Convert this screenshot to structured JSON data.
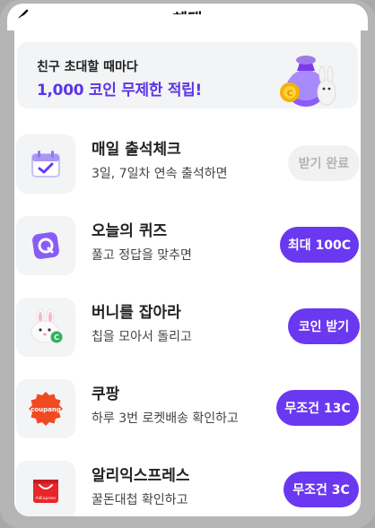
{
  "header": {
    "title": "혜택"
  },
  "banner": {
    "line1": "친구 초대할 때마다",
    "line2": "1,000 코인 무제한 적립!"
  },
  "items": [
    {
      "title": "매일 출석체크",
      "subtitle": "3일, 7일차 연속 출석하면",
      "button": "받기 완료",
      "icon": "calendar-check-icon",
      "done": true
    },
    {
      "title": "오늘의 퀴즈",
      "subtitle": "풀고 정답을 맞추면",
      "button": "최대 100C",
      "icon": "quiz-q-icon"
    },
    {
      "title": "버니를 잡아라",
      "subtitle": "칩을 모아서 돌리고",
      "button": "코인 받기",
      "icon": "bunny-icon"
    },
    {
      "title": "쿠팡",
      "subtitle": "하루 3번 로켓배송 확인하고",
      "button": "무조건 13C",
      "icon": "coupang-logo",
      "logo_text": "coupang"
    },
    {
      "title": "알리익스프레스",
      "subtitle": "꿀돈대첩 확인하고",
      "button": "무조건 3C",
      "icon": "aliexpress-logo",
      "logo_text": "AliExpress"
    }
  ],
  "colors": {
    "accent": "#6a38f0",
    "banner_highlight": "#5b35e6",
    "done_bg": "#f1f1f3"
  }
}
